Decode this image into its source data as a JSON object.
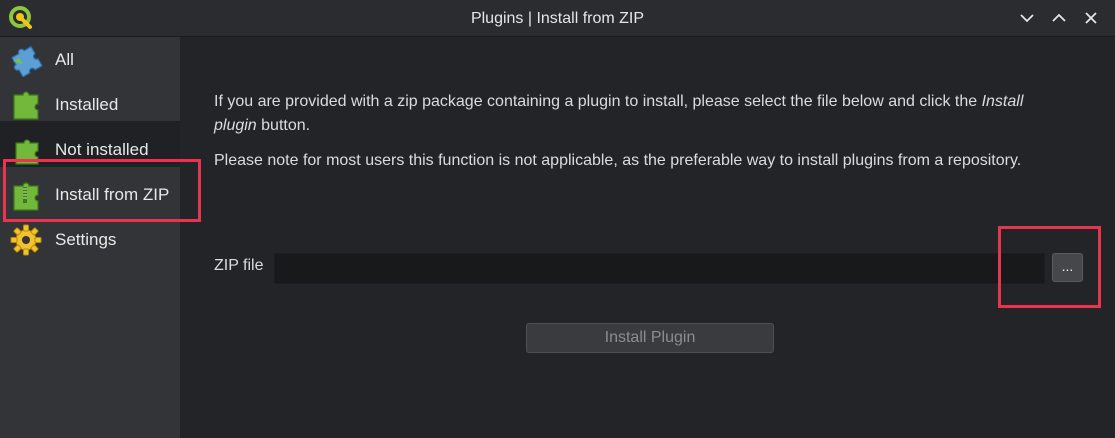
{
  "window": {
    "title": "Plugins | Install from ZIP"
  },
  "sidebar": {
    "items": [
      {
        "label": "All",
        "icon": "puzzle-blue-icon"
      },
      {
        "label": "Installed",
        "icon": "puzzle-green-icon"
      },
      {
        "label": "Not installed",
        "icon": "puzzle-green-partial-icon"
      },
      {
        "label": "Install from ZIP",
        "icon": "zip-puzzle-icon",
        "selected": true
      },
      {
        "label": "Settings",
        "icon": "gear-icon"
      }
    ]
  },
  "main": {
    "intro_part1": "If you are provided with a zip package containing a plugin to install, please select the file below and click the ",
    "intro_italic1": "Install",
    "intro_italic2": "plugin",
    "intro_part2": " button.",
    "note": "Please note for most users this function is not applicable, as the preferable way to install plugins from a repository.",
    "zip_label": "ZIP file",
    "zip_value": "",
    "browse_label": "...",
    "install_label": "Install Plugin"
  },
  "colors": {
    "highlight": "#e8344e",
    "accent_green": "#6dbb3a",
    "accent_yellow": "#f2c12e"
  }
}
